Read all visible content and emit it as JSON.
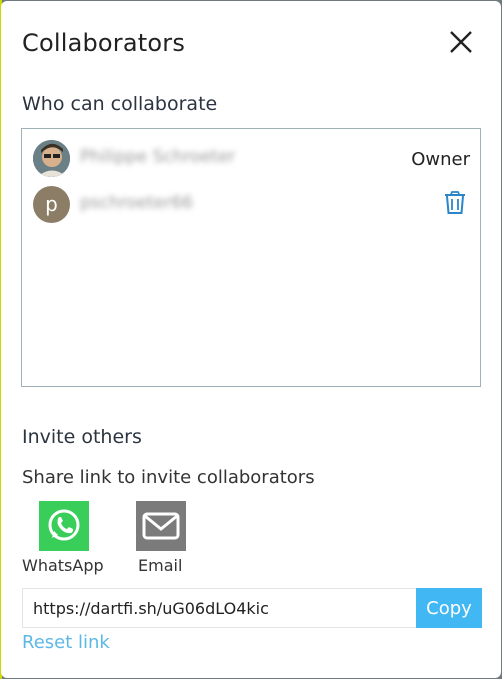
{
  "dialog": {
    "title": "Collaborators",
    "close_icon": "close-icon"
  },
  "collaborators": {
    "heading": "Who can collaborate",
    "items": [
      {
        "name": "Philippe Schroeter",
        "role": "Owner",
        "avatar": "photo"
      },
      {
        "name": "pschroeter66",
        "avatar_letter": "p",
        "action_icon": "trash-icon"
      }
    ]
  },
  "invite": {
    "heading": "Invite others",
    "share_text": "Share link to invite collaborators",
    "whatsapp_label": "WhatsApp",
    "email_label": "Email",
    "link_value": "https://dartfi.sh/uG06dLO4kic",
    "copy_label": "Copy",
    "reset_label": "Reset link"
  },
  "colors": {
    "accent": "#41b8f3",
    "whatsapp": "#39cd5a",
    "email": "#7b7b7b"
  }
}
